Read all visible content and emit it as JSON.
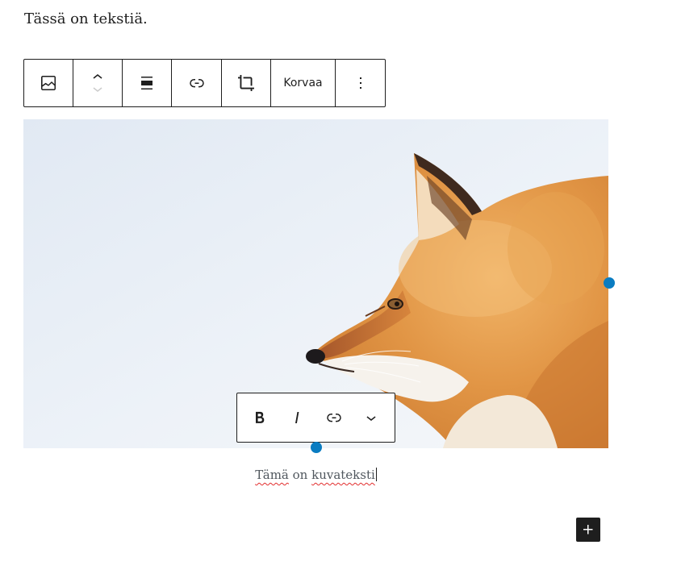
{
  "paragraph": {
    "text": "Tässä on tekstiä."
  },
  "block_toolbar": {
    "block_type_icon": "image-icon",
    "mover": {
      "up_icon": "chevron-up-icon",
      "down_icon": "chevron-down-icon",
      "down_disabled": true
    },
    "align_icon": "align-none-icon",
    "link_icon": "link-icon",
    "crop_icon": "crop-icon",
    "replace_label": "Korvaa",
    "options_icon": "more-vertical-icon"
  },
  "caption_toolbar": {
    "icons": [
      "bold-icon",
      "italic-icon",
      "link-icon",
      "chevron-down-icon"
    ]
  },
  "caption": {
    "segments": [
      {
        "text": "Tämä",
        "misspelled": true
      },
      {
        "text": " on ",
        "misspelled": false
      },
      {
        "text": "kuvateksti",
        "misspelled": true
      }
    ],
    "cursor_visible": true
  },
  "inserter": {
    "icon": "plus-icon"
  },
  "colors": {
    "text": "#1e1e1e",
    "caption_text": "#50575e",
    "accent": "#0a7cc1",
    "spellcheck_underline": "#e22d2d",
    "disabled_icon": "#cccccc"
  }
}
